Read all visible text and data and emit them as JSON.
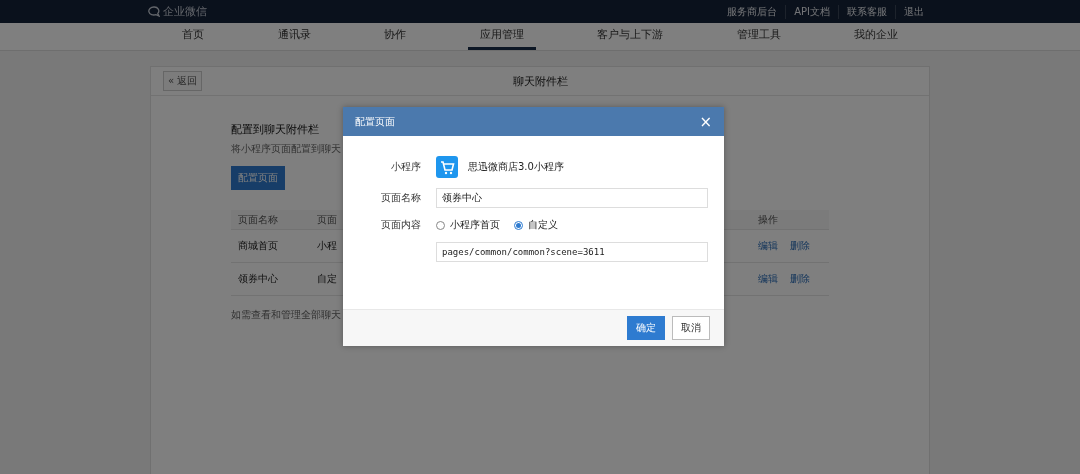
{
  "top_bar": {
    "logo": "企业微信",
    "links": [
      "服务商后台",
      "API文档",
      "联系客服",
      "退出"
    ]
  },
  "nav": [
    {
      "label": "首页",
      "selected": false
    },
    {
      "label": "通讯录",
      "selected": false
    },
    {
      "label": "协作",
      "selected": false
    },
    {
      "label": "应用管理",
      "selected": true
    },
    {
      "label": "客户与上下游",
      "selected": false
    },
    {
      "label": "管理工具",
      "selected": false
    },
    {
      "label": "我的企业",
      "selected": false
    }
  ],
  "card": {
    "back_button": "« 返回",
    "title": "聊天附件栏",
    "section_title": "配置到聊天附件栏",
    "description": "将小程序页面配置到聊天",
    "config_button": "配置页面",
    "table": {
      "columns": [
        "页面名称",
        "页面",
        "操作"
      ],
      "rows": [
        {
          "name": "商城首页",
          "content": "小程",
          "actions": [
            "编辑",
            "删除"
          ]
        },
        {
          "name": "领券中心",
          "content": "自定",
          "actions": [
            "编辑",
            "删除"
          ]
        }
      ]
    },
    "footer_note": "如需查看和管理全部聊天"
  },
  "dialog": {
    "title": "配置页面",
    "close": "×",
    "mini_program_label": "小程序",
    "mini_program_name": "思迅微商店3.0小程序",
    "page_name_label": "页面名称",
    "page_name_value": "领券中心",
    "page_content_label": "页面内容",
    "options": [
      {
        "label": "小程序首页",
        "selected": false
      },
      {
        "label": "自定义",
        "selected": true
      }
    ],
    "path_value": "pages/common/common?scene=3611",
    "buttons": [
      {
        "label": "确定",
        "kind": "primary"
      },
      {
        "label": "取消",
        "kind": "secondary"
      }
    ]
  }
}
